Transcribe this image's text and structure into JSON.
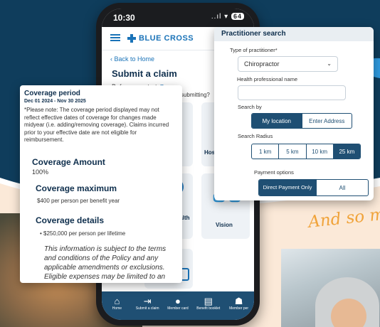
{
  "phone": {
    "time": "10:30",
    "signal": "..ıl",
    "battery": "64",
    "brand": "BLUE CROSS",
    "back_link": "Back to Home",
    "title": "Submit a claim",
    "before_start": "Before you start",
    "question": "What type of claim are you submitting?",
    "tiles": [
      {
        "label": "nce"
      },
      {
        "label": "Hospita"
      },
      {
        "label": "health"
      },
      {
        "label": "ts"
      },
      {
        "label": "Vision"
      }
    ],
    "tabs": [
      {
        "label": "Home"
      },
      {
        "label": "Submit a claim"
      },
      {
        "label": "Member card"
      },
      {
        "label": "Benefit booklet"
      },
      {
        "label": "Member per"
      }
    ]
  },
  "coverage": {
    "period_label": "Coverage period",
    "dates": "Dec 01 2024 - Nov 30 2025",
    "note": "*Please note: The coverage period displayed may not reflect effective dates of coverage for changes made midyear (i.e. adding/removing coverage). Claims incurred prior to your effective date are not eligible for reimbursement.",
    "amount_label": "Coverage Amount",
    "amount_value": "100%",
    "max_label": "Coverage maximum",
    "max_value": "$400 per person per benefit year",
    "details_label": "Coverage details",
    "details_bullet": "$250,000 per person per lifetime",
    "terms": "This information is subject to the terms and conditions of the Policy and any applicable amendments or exclusions. Eligible expenses may be limited to an"
  },
  "search": {
    "title": "Practitioner search",
    "type_label": "Type of practitioner*",
    "type_value": "Chiropractor",
    "name_label": "Health professional name",
    "name_value": "",
    "search_by_label": "Search by",
    "search_by_options": [
      "My location",
      "Enter Address"
    ],
    "radius_label": "Search Radius",
    "radius_options": [
      "1 km",
      "5 km",
      "10 km",
      "25 km"
    ],
    "payment_label": "Payment options",
    "payment_options": [
      "Direct Payment Only",
      "All"
    ]
  },
  "tagline": "And so m",
  "colors": {
    "navy": "#0f3d5c",
    "brand_blue": "#1a73b8",
    "tab_bar": "#1f4f73",
    "accent_orange": "#f0a33a"
  }
}
